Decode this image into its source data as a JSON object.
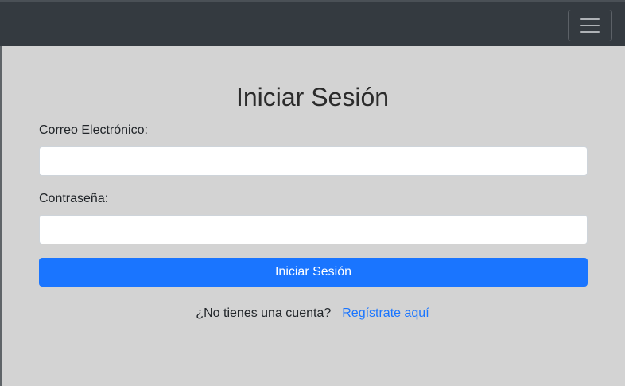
{
  "navbar": {
    "toggler_icon": "hamburger-menu-icon"
  },
  "login": {
    "title": "Iniciar Sesión",
    "email_label": "Correo Electrónico:",
    "email_value": "",
    "password_label": "Contraseña:",
    "password_value": "",
    "submit_label": "Iniciar Sesión",
    "no_account_text": "¿No tienes una cuenta?",
    "register_link": "Regístrate aquí"
  },
  "colors": {
    "navbar_bg": "#343a40",
    "page_bg": "#d3d3d3",
    "primary": "#1a75ff"
  }
}
